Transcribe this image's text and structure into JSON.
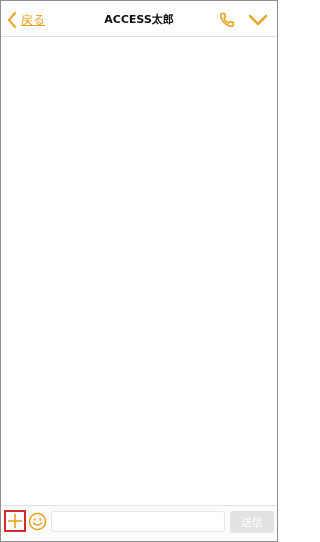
{
  "header": {
    "back_label": "戻る",
    "title": "ACCESS太郎",
    "back_icon": "chevron-left-icon",
    "call_icon": "phone-icon",
    "menu_icon": "chevron-down-icon"
  },
  "footer": {
    "add_icon": "plus-icon",
    "emoji_icon": "smiley-icon",
    "message_value": "",
    "message_placeholder": "",
    "send_label": "送信"
  },
  "colors": {
    "accent": "#e8a21f",
    "highlight_border": "#d42a2a",
    "send_disabled": "#e2e2e2"
  }
}
